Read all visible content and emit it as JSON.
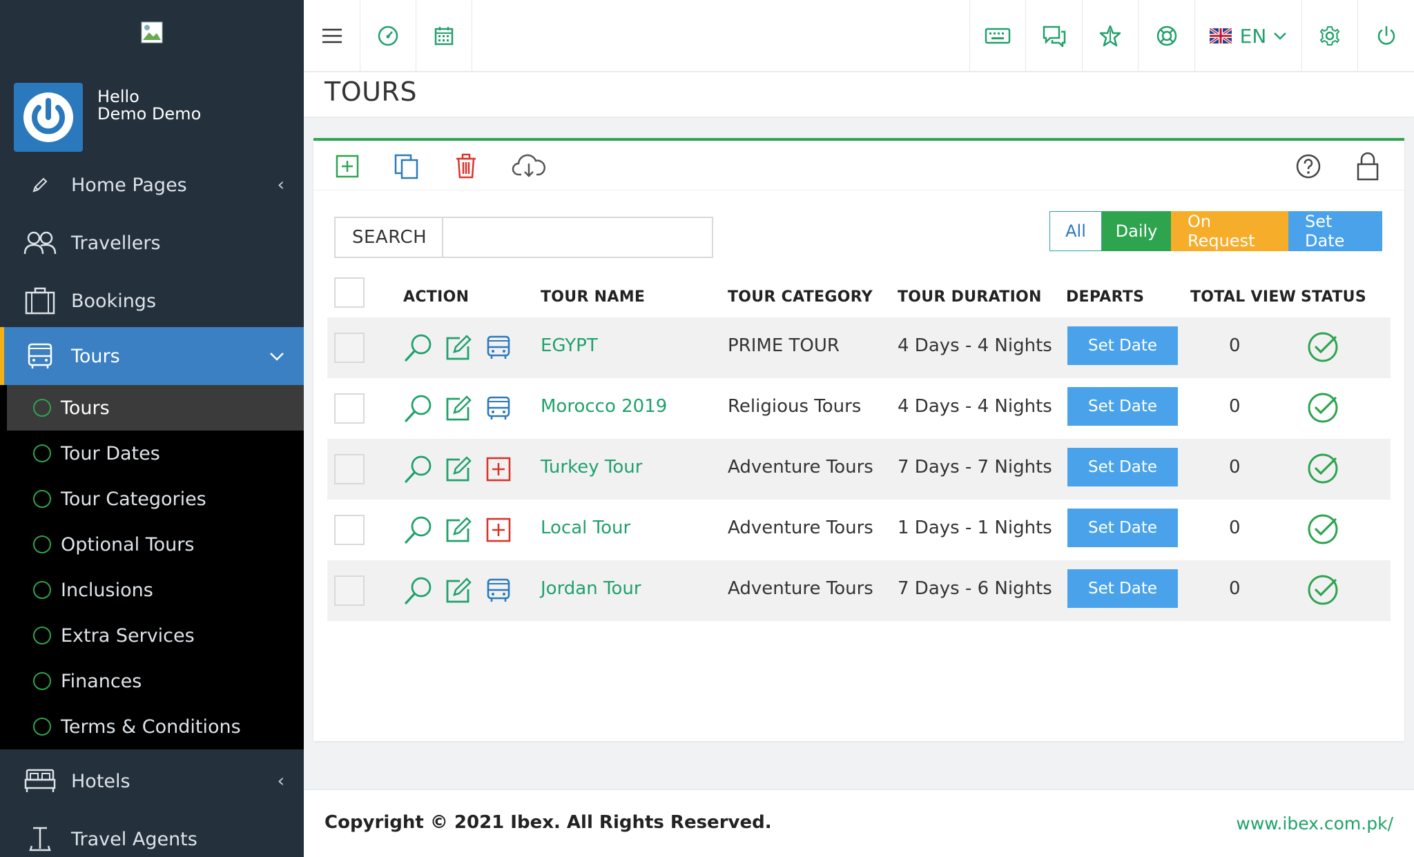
{
  "colors": {
    "sidebar_bg": "#24303b",
    "accent_blue": "#3a80c3",
    "accent_green": "#2ea44f",
    "link_green": "#20a16a",
    "orange": "#f6ad2a",
    "light_blue": "#4aa3ea",
    "danger": "#d9342b"
  },
  "user": {
    "greeting": "Hello",
    "name": "Demo Demo"
  },
  "sidebar": {
    "items": [
      {
        "label": "Home Pages",
        "icon": "pencil-icon",
        "caret": "‹"
      },
      {
        "label": "Travellers",
        "icon": "users-icon"
      },
      {
        "label": "Bookings",
        "icon": "briefcase-icon"
      },
      {
        "label": "Tours",
        "icon": "bus-icon",
        "caret": "⌄"
      },
      {
        "label": "Hotels",
        "icon": "bed-icon",
        "caret": "‹"
      },
      {
        "label": "Travel Agents",
        "icon": "agent-icon"
      }
    ],
    "submenu": [
      {
        "label": "Tours"
      },
      {
        "label": "Tour Dates"
      },
      {
        "label": "Tour Categories"
      },
      {
        "label": "Optional Tours"
      },
      {
        "label": "Inclusions"
      },
      {
        "label": "Extra Services"
      },
      {
        "label": "Finances"
      },
      {
        "label": "Terms & Conditions"
      }
    ]
  },
  "topbar": {
    "language": "EN",
    "icons": [
      "menu-icon",
      "dashboard-icon",
      "calendar-icon",
      "keyboard-icon",
      "chat-icon",
      "star-icon",
      "support-icon",
      "uk-flag-icon",
      "settings-icon",
      "power-icon"
    ]
  },
  "page": {
    "title": "TOURS"
  },
  "toolbar": {
    "icons": [
      "add-icon",
      "copy-icon",
      "delete-icon",
      "download-icon",
      "help-icon",
      "lock-icon"
    ]
  },
  "search": {
    "label": "SEARCH",
    "value": "",
    "placeholder": ""
  },
  "filters": {
    "all": "All",
    "daily": "Daily",
    "on_request": "On Request",
    "set_date": "Set Date"
  },
  "table": {
    "headers": {
      "action": "ACTION",
      "name": "TOUR NAME",
      "category": "TOUR CATEGORY",
      "duration": "TOUR DURATION",
      "departs": "DEPARTS",
      "views": "TOTAL VIEW",
      "status": "STATUS"
    },
    "rows": [
      {
        "name": "EGYPT",
        "category": "PRIME TOUR",
        "duration": "4 Days - 4 Nights",
        "departs": "Set Date",
        "views": "0",
        "third_icon": "bus-icon"
      },
      {
        "name": "Morocco 2019",
        "category": "Religious Tours",
        "duration": "4 Days - 4 Nights",
        "departs": "Set Date",
        "views": "0",
        "third_icon": "bus-icon"
      },
      {
        "name": "Turkey Tour",
        "category": "Adventure Tours",
        "duration": "7 Days - 7 Nights",
        "departs": "Set Date",
        "views": "0",
        "third_icon": "plus-square-icon"
      },
      {
        "name": "Local Tour",
        "category": "Adventure Tours",
        "duration": "1 Days - 1 Nights",
        "departs": "Set Date",
        "views": "0",
        "third_icon": "plus-square-icon"
      },
      {
        "name": "Jordan Tour",
        "category": "Adventure Tours",
        "duration": "7 Days - 6 Nights",
        "departs": "Set Date",
        "views": "0",
        "third_icon": "bus-icon"
      }
    ]
  },
  "footer": {
    "copyright": "Copyright © 2021 Ibex. All Rights Reserved.",
    "link": "www.ibex.com.pk/"
  }
}
